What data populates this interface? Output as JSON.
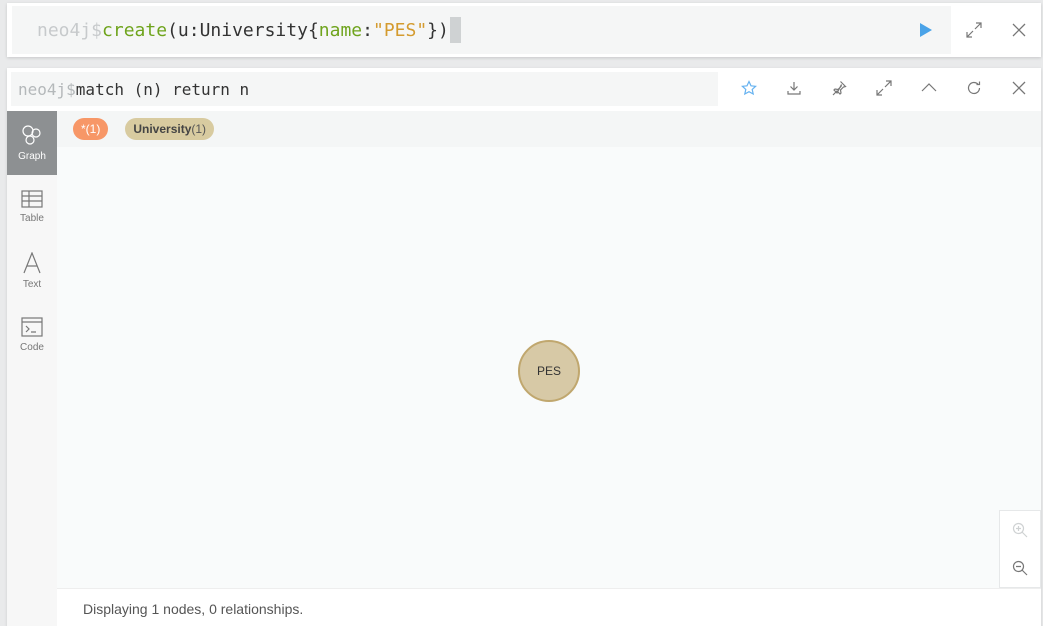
{
  "editor": {
    "prompt": "neo4j$",
    "query_parts": {
      "keyword": "create",
      "open": "(u:University{",
      "prop": "name",
      "colon": ":",
      "value": "\"PES\"",
      "close": "})"
    }
  },
  "frame": {
    "prompt": "neo4j$",
    "query": "match (n) return n"
  },
  "sidebar": {
    "items": [
      {
        "label": "Graph"
      },
      {
        "label": "Table"
      },
      {
        "label": "Text"
      },
      {
        "label": "Code"
      }
    ]
  },
  "legend": {
    "all_label": "*(1)",
    "university_name": "University",
    "university_count": "(1)"
  },
  "graph": {
    "node_label": "PES"
  },
  "status": {
    "text": "Displaying 1 nodes, 0 relationships."
  },
  "colors": {
    "accent_run": "#4aa3e8",
    "star_icon": "#66b2f0",
    "pill_all": "#f79767",
    "pill_university": "#d8cba0",
    "node_fill": "#d7c9a6",
    "node_border": "#c0a76e"
  }
}
